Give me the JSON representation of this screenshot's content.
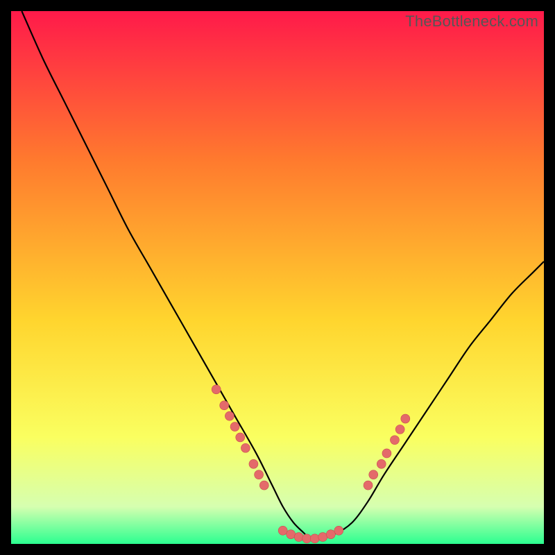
{
  "watermark": "TheBottleneck.com",
  "colors": {
    "frame": "#000000",
    "gradient_top": "#ff1a4a",
    "gradient_upper_mid": "#ff7a2e",
    "gradient_mid": "#ffd52e",
    "gradient_lower_mid": "#faff60",
    "gradient_near_bottom": "#d6ffb0",
    "gradient_bottom": "#2bff90",
    "curve": "#000000",
    "marker_fill": "#e46a6a",
    "marker_stroke": "#c94f4f"
  },
  "chart_data": {
    "type": "line",
    "title": "",
    "xlabel": "",
    "ylabel": "",
    "xlim": [
      0,
      100
    ],
    "ylim": [
      0,
      100
    ],
    "series": [
      {
        "name": "bottleneck-curve",
        "x": [
          2,
          6,
          10,
          14,
          18,
          22,
          26,
          30,
          34,
          38,
          42,
          46,
          49,
          51,
          53,
          55,
          56,
          58,
          61,
          64,
          67,
          70,
          74,
          78,
          82,
          86,
          90,
          94,
          98,
          100
        ],
        "y": [
          100,
          91,
          83,
          75,
          67,
          59,
          52,
          45,
          38,
          31,
          24,
          17,
          11,
          7,
          4,
          2,
          1,
          1,
          2,
          4,
          8,
          13,
          19,
          25,
          31,
          37,
          42,
          47,
          51,
          53
        ]
      }
    ],
    "marker_clusters": [
      {
        "name": "left-descent-markers",
        "points": [
          {
            "x": 38.5,
            "y": 29
          },
          {
            "x": 40,
            "y": 26
          },
          {
            "x": 41,
            "y": 24
          },
          {
            "x": 42,
            "y": 22
          },
          {
            "x": 43,
            "y": 20
          },
          {
            "x": 44,
            "y": 18
          },
          {
            "x": 45.5,
            "y": 15
          },
          {
            "x": 46.5,
            "y": 13
          },
          {
            "x": 47.5,
            "y": 11
          }
        ]
      },
      {
        "name": "valley-floor-markers",
        "points": [
          {
            "x": 51,
            "y": 2.5
          },
          {
            "x": 52.5,
            "y": 1.8
          },
          {
            "x": 54,
            "y": 1.3
          },
          {
            "x": 55.5,
            "y": 1
          },
          {
            "x": 57,
            "y": 1
          },
          {
            "x": 58.5,
            "y": 1.3
          },
          {
            "x": 60,
            "y": 1.8
          },
          {
            "x": 61.5,
            "y": 2.5
          }
        ]
      },
      {
        "name": "right-ascent-markers",
        "points": [
          {
            "x": 67,
            "y": 11
          },
          {
            "x": 68,
            "y": 13
          },
          {
            "x": 69.5,
            "y": 15
          },
          {
            "x": 70.5,
            "y": 17
          },
          {
            "x": 72,
            "y": 19.5
          },
          {
            "x": 73,
            "y": 21.5
          },
          {
            "x": 74,
            "y": 23.5
          }
        ]
      }
    ]
  }
}
